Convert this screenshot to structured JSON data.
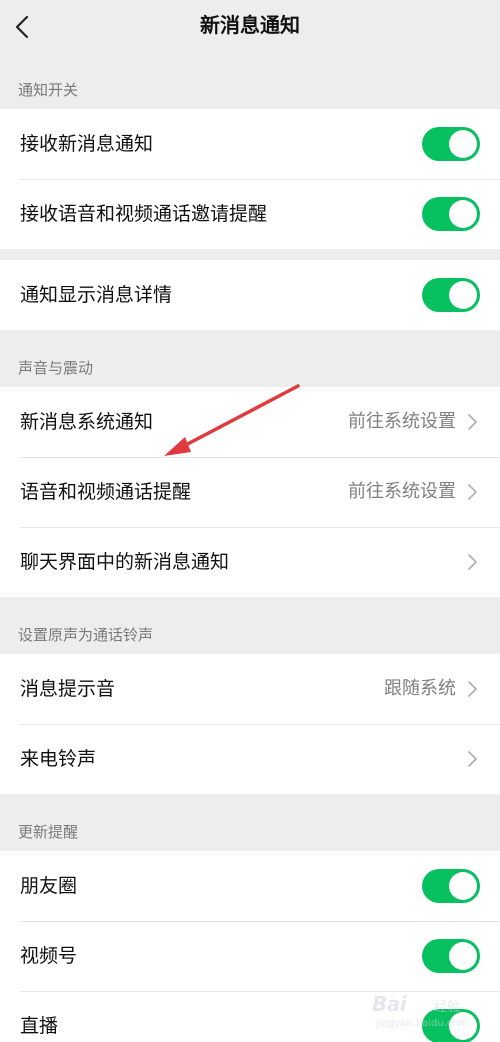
{
  "header": {
    "back_icon": "chevron-left-icon",
    "title": "新消息通知"
  },
  "sections": {
    "notify_switch": "通知开关",
    "sound_vibration": "声音与震动",
    "ringtone": "设置原声为通话铃声",
    "update_remind": "更新提醒"
  },
  "rows": {
    "receive_new_msg": {
      "label": "接收新消息通知",
      "toggle": "on"
    },
    "receive_call_invite": {
      "label": "接收语音和视频通话邀请提醒",
      "toggle": "on"
    },
    "show_msg_detail": {
      "label": "通知显示消息详情",
      "toggle": "on"
    },
    "new_msg_system": {
      "label": "新消息系统通知",
      "value": "前往系统设置"
    },
    "call_remind": {
      "label": "语音和视频通话提醒",
      "value": "前往系统设置"
    },
    "chat_new_msg": {
      "label": "聊天界面中的新消息通知"
    },
    "msg_tone": {
      "label": "消息提示音",
      "value": "跟随系统"
    },
    "incoming_ringtone": {
      "label": "来电铃声"
    },
    "moments": {
      "label": "朋友圈",
      "toggle": "on"
    },
    "channels": {
      "label": "视频号",
      "toggle": "on"
    },
    "live": {
      "label": "直播",
      "toggle": "on"
    }
  },
  "colors": {
    "toggle_on": "#07c160",
    "annotation_arrow": "#e0393e",
    "background": "#ededed"
  },
  "watermark": {
    "brand": "Bai",
    "suffix": "经验",
    "url": "jingyan.baidu.com"
  }
}
